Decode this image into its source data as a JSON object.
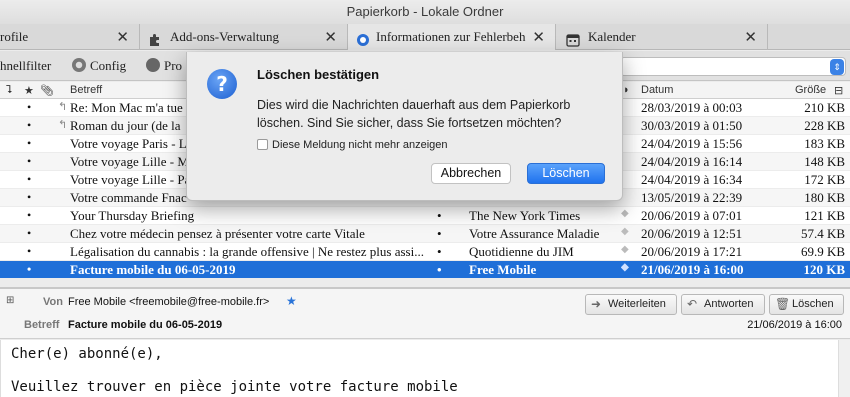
{
  "window": {
    "title": "Papierkorb - Lokale Ordner"
  },
  "tabs": [
    {
      "label": "rofile",
      "close": "✕"
    },
    {
      "label": "Add-ons-Verwaltung",
      "close": "✕"
    },
    {
      "label": "Informationen zur Fehlerbeh",
      "close": "✕"
    },
    {
      "label": "Kalender",
      "close": "✕"
    }
  ],
  "toolbar": {
    "quickfilter": "hnellfilter",
    "config": "Config",
    "pro": "Pro"
  },
  "columns": {
    "subject": "Betreff",
    "date": "Datum",
    "size": "Größe"
  },
  "messages": [
    {
      "dot": "•",
      "arrow": "↰",
      "subject": "Re: Mon Mac m'a tue",
      "sdot": "",
      "sender": "",
      "flag": "",
      "date": "28/03/2019 à 00:03",
      "size": "210 KB",
      "selected": false
    },
    {
      "dot": "•",
      "arrow": "↰",
      "subject": "Roman du jour (de la",
      "sdot": "",
      "sender": "",
      "flag": "",
      "date": "30/03/2019 à 01:50",
      "size": "228 KB",
      "selected": false
    },
    {
      "dot": "•",
      "arrow": "",
      "subject": "Votre voyage Paris - L",
      "sdot": "",
      "sender": "",
      "flag": "",
      "date": "24/04/2019 à 15:56",
      "size": "183 KB",
      "selected": false
    },
    {
      "dot": "•",
      "arrow": "",
      "subject": "Votre voyage Lille - M",
      "sdot": "",
      "sender": "",
      "flag": "",
      "date": "24/04/2019 à 16:14",
      "size": "148 KB",
      "selected": false
    },
    {
      "dot": "•",
      "arrow": "",
      "subject": "Votre voyage Lille - Pa",
      "sdot": "",
      "sender": "",
      "flag": "",
      "date": "24/04/2019 à 16:34",
      "size": "172 KB",
      "selected": false
    },
    {
      "dot": "•",
      "arrow": "",
      "subject": "Votre commande Fnac",
      "sdot": "",
      "sender": "",
      "flag": "",
      "date": "13/05/2019 à 22:39",
      "size": "180 KB",
      "selected": false
    },
    {
      "dot": "•",
      "arrow": "",
      "subject": "Your Thursday Briefing",
      "sdot": "•",
      "sender": "The New York Times",
      "flag": "◆",
      "date": "20/06/2019 à 07:01",
      "size": "121 KB",
      "selected": false
    },
    {
      "dot": "•",
      "arrow": "",
      "subject": "Chez votre médecin pensez à présenter votre carte Vitale",
      "sdot": "•",
      "sender": "Votre Assurance Maladie",
      "flag": "◆",
      "date": "20/06/2019 à 12:51",
      "size": "57.4 KB",
      "selected": false
    },
    {
      "dot": "•",
      "arrow": "",
      "subject": "Légalisation du cannabis : la grande offensive | Ne restez plus assi...",
      "sdot": "•",
      "sender": "Quotidienne du JIM",
      "flag": "◆",
      "date": "20/06/2019 à 17:21",
      "size": "69.9 KB",
      "selected": false
    },
    {
      "dot": "•",
      "arrow": "",
      "subject": "Facture mobile du 06-05-2019",
      "sdot": "•",
      "sender": "Free Mobile",
      "flag": "◆",
      "date": "21/06/2019 à 16:00",
      "size": "120 KB",
      "selected": true
    }
  ],
  "message_view": {
    "from_label": "Von",
    "from_value": "Free Mobile <freemobile@free-mobile.fr>",
    "subject_label": "Betreff",
    "subject_value": "Facture mobile du 06-05-2019",
    "date": "21/06/2019 à 16:00",
    "forward": "Weiterleiten",
    "reply": "Antworten",
    "delete": "Löschen",
    "body_lines": [
      "Cher(e) abonné(e),",
      "Veuillez trouver en pièce jointe votre facture mobile"
    ]
  },
  "dialog": {
    "title": "Löschen bestätigen",
    "message": "Dies wird die Nachrichten dauerhaft aus dem Papierkorb löschen. Sind Sie sicher, dass Sie fortsetzen möchten?",
    "checkbox_label": "Diese Meldung nicht mehr anzeigen",
    "cancel": "Abbrechen",
    "confirm": "Löschen",
    "icon_glyph": "?"
  }
}
